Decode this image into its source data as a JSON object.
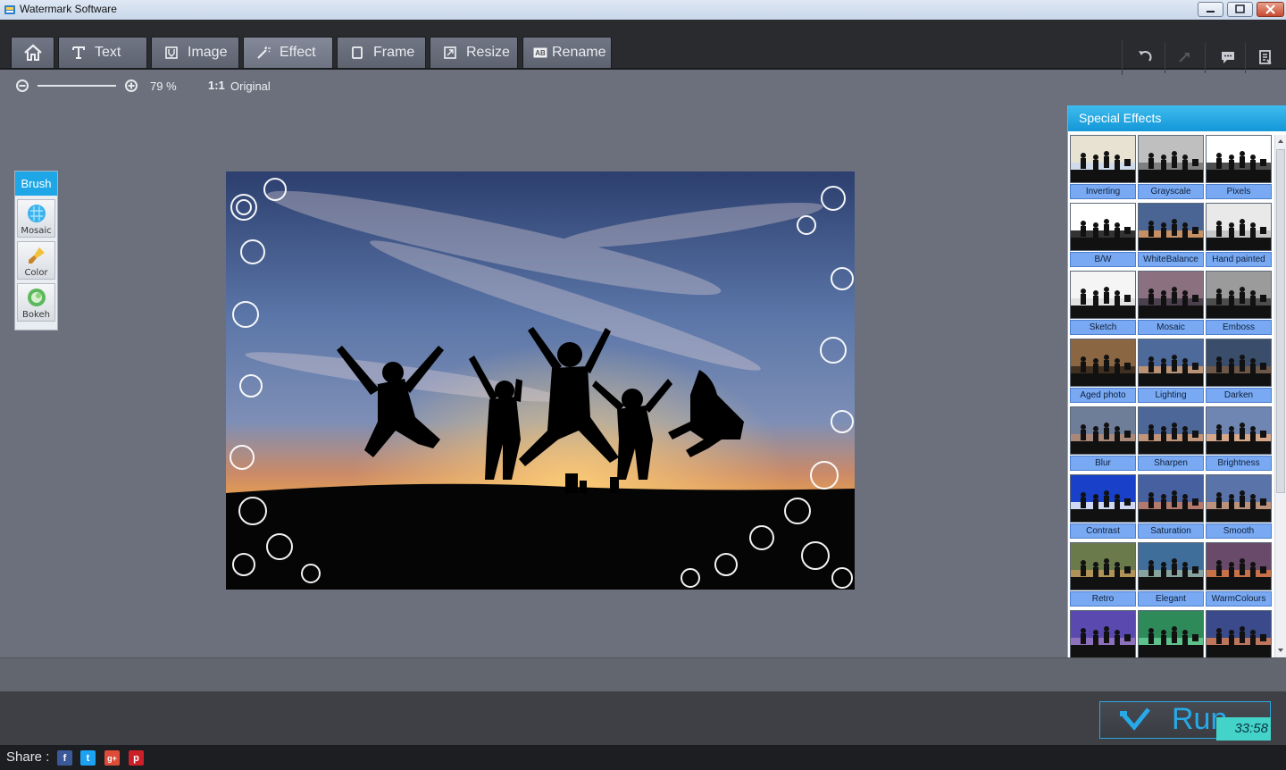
{
  "window": {
    "title": "Watermark Software"
  },
  "tabs": [
    {
      "id": "home",
      "label": ""
    },
    {
      "id": "text",
      "label": "Text"
    },
    {
      "id": "image",
      "label": "Image"
    },
    {
      "id": "effect",
      "label": "Effect"
    },
    {
      "id": "frame",
      "label": "Frame"
    },
    {
      "id": "resize",
      "label": "Resize"
    },
    {
      "id": "rename",
      "label": "Rename"
    }
  ],
  "toolbar_right": [
    "undo-icon",
    "redo-icon",
    "comment-icon",
    "list-icon"
  ],
  "zoom": {
    "value": "79 %",
    "original_label": "Original",
    "ratio_icon": "1:1",
    "level": 0.79
  },
  "brush": {
    "header": "Brush",
    "items": [
      {
        "label": "Mosaic"
      },
      {
        "label": "Color"
      },
      {
        "label": "Bokeh"
      }
    ]
  },
  "effects": {
    "header": "Special Effects",
    "items": [
      {
        "label": "Inverting"
      },
      {
        "label": "Grayscale"
      },
      {
        "label": "Pixels"
      },
      {
        "label": "B/W"
      },
      {
        "label": "WhiteBalance"
      },
      {
        "label": "Hand painted"
      },
      {
        "label": "Sketch"
      },
      {
        "label": "Mosaic"
      },
      {
        "label": "Emboss"
      },
      {
        "label": "Aged photo"
      },
      {
        "label": "Lighting"
      },
      {
        "label": "Darken"
      },
      {
        "label": "Blur"
      },
      {
        "label": "Sharpen"
      },
      {
        "label": "Brightness"
      },
      {
        "label": "Contrast"
      },
      {
        "label": "Saturation"
      },
      {
        "label": "Smooth"
      },
      {
        "label": "Retro"
      },
      {
        "label": "Elegant"
      },
      {
        "label": "WarmColours"
      },
      {
        "label": ""
      },
      {
        "label": ""
      },
      {
        "label": ""
      }
    ]
  },
  "run": {
    "label": "Run"
  },
  "timer": "33:58",
  "share": {
    "label": "Share :",
    "icons": [
      "f",
      "t",
      "g+",
      "p"
    ]
  },
  "colors": {
    "accent": "#1ea6e6",
    "toolbar": "#2a2b2f",
    "workspace": "#6b707c",
    "fx_label": "#78a9f2",
    "run": "#27a9e8"
  }
}
